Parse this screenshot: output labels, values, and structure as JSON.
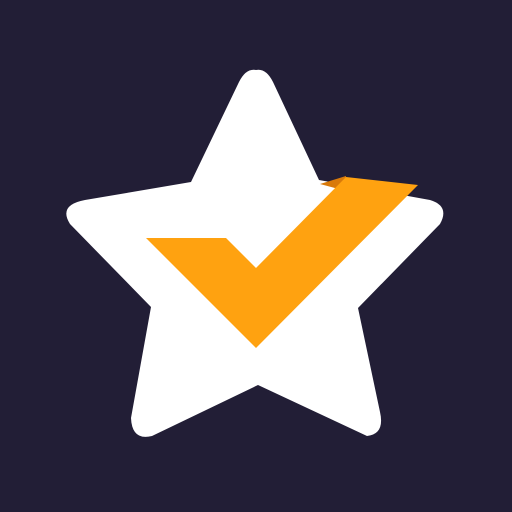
{
  "app_icon": {
    "icon_name": "star-check-icon",
    "colors": {
      "background": "#221E36",
      "star": "#FFFFFF",
      "check": "#FFA210",
      "check_shadow": "#D97A0A"
    }
  }
}
